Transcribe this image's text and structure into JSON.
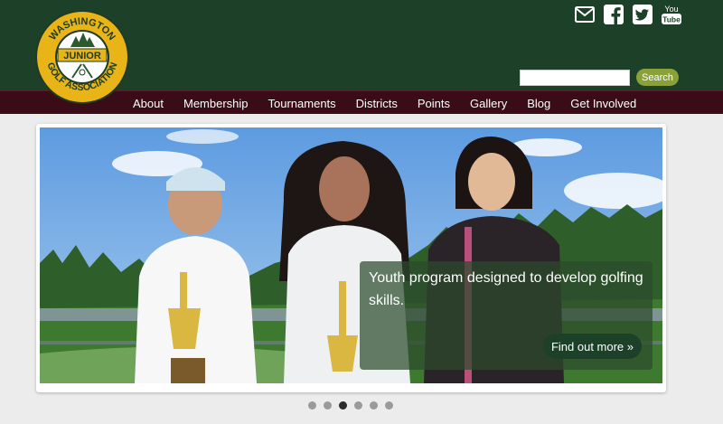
{
  "logo": {
    "top_text": "WASHINGTON",
    "center_text": "JUNIOR",
    "bottom_text": "GOLF ASSOCIATION"
  },
  "social": {
    "icons": [
      "email-icon",
      "facebook-icon",
      "twitter-icon",
      "youtube-icon"
    ],
    "youtube_top": "You",
    "youtube_bottom": "Tube"
  },
  "search": {
    "placeholder": "",
    "value": "",
    "button_label": "Search"
  },
  "nav": {
    "items": [
      {
        "label": "About"
      },
      {
        "label": "Membership"
      },
      {
        "label": "Tournaments"
      },
      {
        "label": "Districts"
      },
      {
        "label": "Points"
      },
      {
        "label": "Gallery"
      },
      {
        "label": "Blog"
      },
      {
        "label": "Get Involved"
      }
    ]
  },
  "slider": {
    "caption": "Youth program designed to develop golfing skills.",
    "cta_label": "Find out more »",
    "slide_count": 6,
    "active_index": 2
  },
  "colors": {
    "header_bg": "#1d4029",
    "nav_bg": "#3a0c17",
    "logo_gold": "#e8b417",
    "search_button": "#8aa13a"
  }
}
